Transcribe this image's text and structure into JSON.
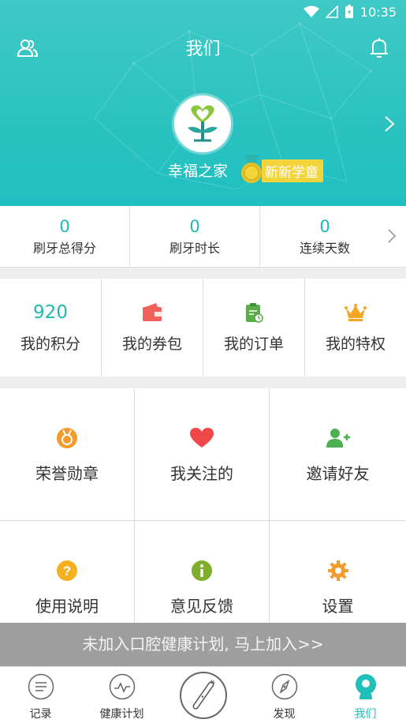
{
  "status_bar": {
    "time": "10:35"
  },
  "header": {
    "title": "我们",
    "username": "幸福之家",
    "level_badge": "新新学童"
  },
  "stats": [
    {
      "value": "0",
      "label": "刷牙总得分"
    },
    {
      "value": "0",
      "label": "刷牙时长"
    },
    {
      "value": "0",
      "label": "连续天数"
    }
  ],
  "wallet": {
    "points_value": "920",
    "points_label": "我的积分",
    "coupons_label": "我的券包",
    "orders_label": "我的订单",
    "privileges_label": "我的特权"
  },
  "grid": {
    "medals_label": "荣誉勋章",
    "following_label": "我关注的",
    "invite_label": "邀请好友",
    "manual_label": "使用说明",
    "feedback_label": "意见反馈",
    "settings_label": "设置"
  },
  "join_banner": "未加入口腔健康计划, 马上加入>>",
  "tabs": [
    {
      "label": "记录"
    },
    {
      "label": "健康计划"
    },
    {
      "label": "发现"
    },
    {
      "label": "我们"
    }
  ],
  "colors": {
    "accent": "#20b8b0",
    "header_bg": "#2cc3c0",
    "badge": "#f3d43a",
    "banner_bg": "#9e9e9e"
  }
}
